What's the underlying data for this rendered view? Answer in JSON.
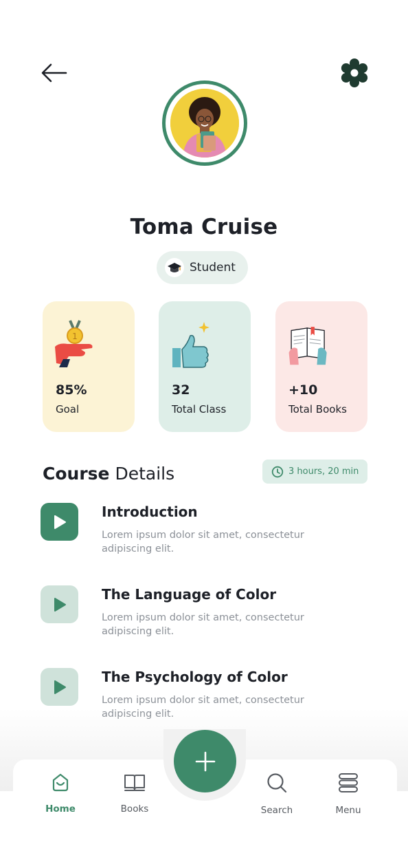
{
  "profile": {
    "name": "Toma Cruise",
    "role": "Student"
  },
  "stats": [
    {
      "value": "85%",
      "label": "Goal"
    },
    {
      "value": "32",
      "label": "Total Class"
    },
    {
      "value": "+10",
      "label": "Total Books"
    }
  ],
  "course": {
    "title_bold": "Course",
    "title_rest": " Details",
    "duration": "3 hours, 20 min",
    "lessons": [
      {
        "title": "Introduction",
        "description": "Lorem ipsum dolor sit amet, consectetur adipiscing elit."
      },
      {
        "title": "The Language of Color",
        "description": "Lorem ipsum dolor sit amet, consectetur adipiscing elit."
      },
      {
        "title": "The Psychology of Color",
        "description": "Lorem ipsum dolor sit amet, consectetur adipiscing elit."
      }
    ]
  },
  "nav": {
    "items": [
      {
        "label": "Home",
        "icon": "home-icon",
        "active": true
      },
      {
        "label": "Books",
        "icon": "book-icon",
        "active": false
      },
      {
        "label": "Search",
        "icon": "search-icon",
        "active": false
      },
      {
        "label": "Menu",
        "icon": "menu-icon",
        "active": false
      }
    ],
    "fab_icon": "plus-icon"
  },
  "colors": {
    "accent": "#3e8a6a",
    "goal_card": "#fcf3d5",
    "class_card": "#deeee8",
    "books_card": "#fce8e6",
    "muted_play": "#cfe2da"
  }
}
